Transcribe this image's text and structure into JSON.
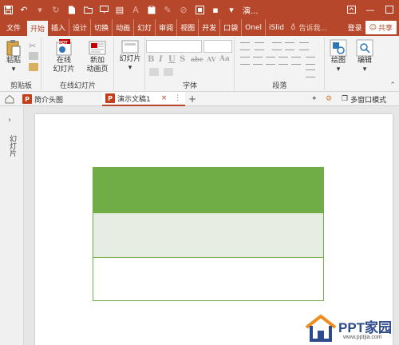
{
  "titlebar": {
    "title": "演...",
    "icons": [
      "save-icon",
      "undo-icon",
      "redo-icon",
      "new-file-icon",
      "open-folder-icon",
      "slideshow-icon",
      "layout-icon",
      "font-color-icon",
      "paste-special-icon",
      "brush-icon",
      "shape-icon",
      "screenshot-icon",
      "more-icon"
    ],
    "window_buttons": [
      "ribbon-display-icon",
      "minimize-icon",
      "maximize-icon"
    ]
  },
  "tabs": [
    {
      "label": "文件"
    },
    {
      "label": "开始",
      "active": true
    },
    {
      "label": "插入"
    },
    {
      "label": "设计"
    },
    {
      "label": "切换"
    },
    {
      "label": "动画"
    },
    {
      "label": "幻灯"
    },
    {
      "label": "审阅"
    },
    {
      "label": "视图"
    },
    {
      "label": "开发"
    },
    {
      "label": "口袋"
    },
    {
      "label": "Onel"
    },
    {
      "label": "iSlid"
    }
  ],
  "tellme": "告诉我...",
  "login": "登录",
  "share": "共享",
  "ribbon": {
    "paste_label": "粘贴",
    "clipboard_label": "剪贴板",
    "online_slide_label": "在线\n幻灯片",
    "new_anim_label": "新加\n动画页",
    "online_group_label": "在线幻灯片",
    "slides_label": "幻灯片",
    "font_label": "字体",
    "paragraph_label": "段落",
    "drawing_label": "绘图",
    "editing_label": "编辑",
    "hot_badge": "HOT",
    "font_buttons": [
      "B",
      "I",
      "U",
      "S",
      "abc",
      "AV",
      "Aa"
    ]
  },
  "doctabs": {
    "tab1": "简介头图",
    "tab2": "演示文稿1",
    "add": "+",
    "multi_window": "多窗口模式"
  },
  "leftpane": {
    "label": "幻灯片"
  },
  "watermark": {
    "brand": "PPT家园",
    "url": "www.pptjia.com"
  },
  "colors": {
    "accent": "#b7472a",
    "table_header": "#70ad47",
    "table_band": "#e8ede4"
  }
}
